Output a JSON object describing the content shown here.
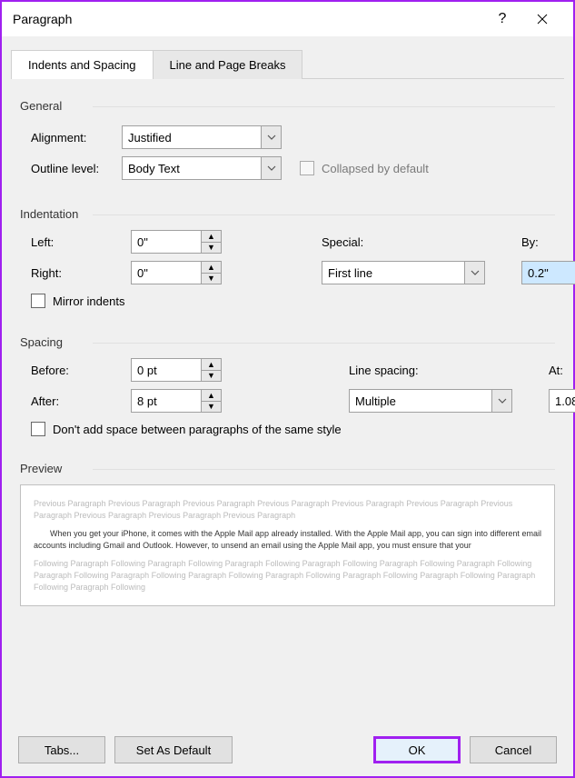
{
  "titlebar": {
    "title": "Paragraph"
  },
  "tabs": {
    "indents": "Indents and Spacing",
    "breaks": "Line and Page Breaks"
  },
  "sections": {
    "general": "General",
    "indentation": "Indentation",
    "spacing": "Spacing",
    "preview": "Preview"
  },
  "general": {
    "alignment_label": "Alignment:",
    "alignment_value": "Justified",
    "outline_label": "Outline level:",
    "outline_value": "Body Text",
    "collapsed_label": "Collapsed by default"
  },
  "indentation": {
    "left_label": "Left:",
    "left_value": "0\"",
    "right_label": "Right:",
    "right_value": "0\"",
    "special_label": "Special:",
    "special_value": "First line",
    "by_label": "By:",
    "by_value": "0.2\"",
    "mirror_label": "Mirror indents"
  },
  "spacing": {
    "before_label": "Before:",
    "before_value": "0 pt",
    "after_label": "After:",
    "after_value": "8 pt",
    "line_label": "Line spacing:",
    "line_value": "Multiple",
    "at_label": "At:",
    "at_value": "1.08",
    "dont_add_label": "Don't add space between paragraphs of the same style"
  },
  "preview": {
    "prev": "Previous Paragraph Previous Paragraph Previous Paragraph Previous Paragraph Previous Paragraph Previous Paragraph Previous Paragraph Previous Paragraph Previous Paragraph Previous Paragraph",
    "mid": "When you get your iPhone, it comes with the Apple Mail app already installed. With the Apple Mail app, you can sign into different email accounts including Gmail and Outlook. However, to unsend an email using the Apple Mail app, you must ensure that your",
    "next": "Following Paragraph Following Paragraph Following Paragraph Following Paragraph Following Paragraph Following Paragraph Following Paragraph Following Paragraph Following Paragraph Following Paragraph Following Paragraph Following Paragraph Following Paragraph Following Paragraph Following"
  },
  "buttons": {
    "tabs": "Tabs...",
    "default": "Set As Default",
    "ok": "OK",
    "cancel": "Cancel"
  }
}
